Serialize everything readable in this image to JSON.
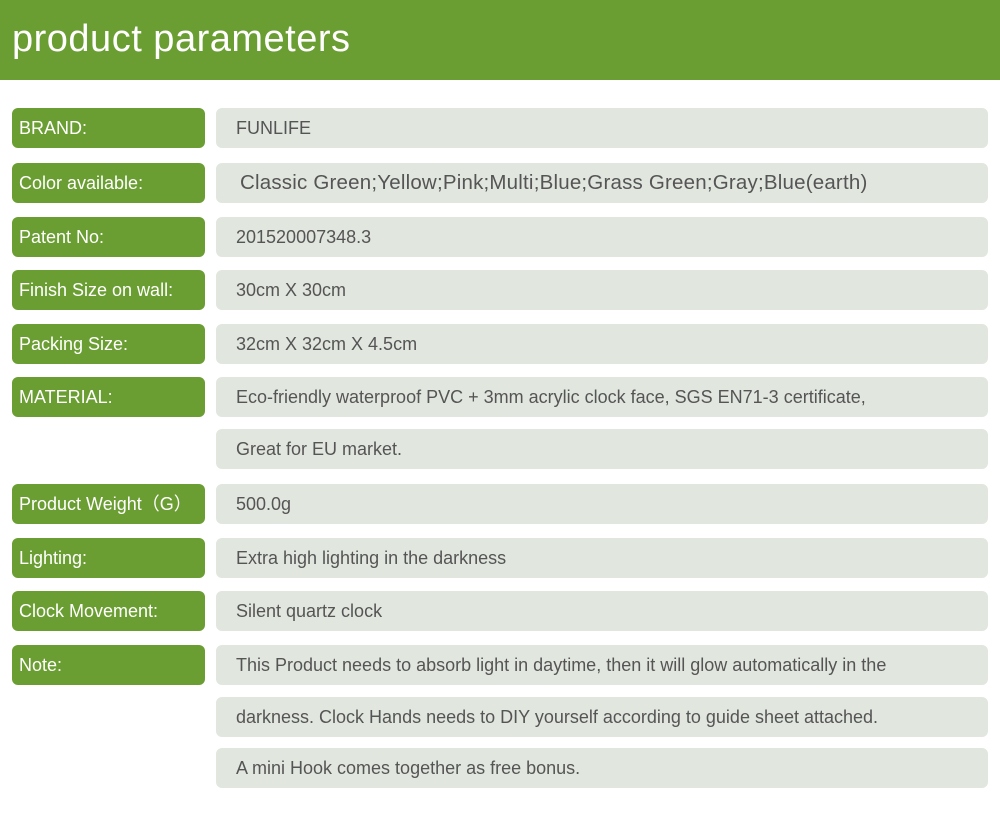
{
  "header": {
    "title": "product  parameters"
  },
  "rows": {
    "brand": {
      "label": "BRAND:",
      "value": "FUNLIFE"
    },
    "color": {
      "label": "Color available:",
      "value": "Classic Green;Yellow;Pink;Multi;Blue;Grass Green;Gray;Blue(earth)"
    },
    "patent": {
      "label": "Patent No:",
      "value": "201520007348.3"
    },
    "finish_size": {
      "label": "Finish Size on wall:",
      "value": "30cm X 30cm"
    },
    "packing_size": {
      "label": "Packing Size:",
      "value": "32cm X 32cm X 4.5cm"
    },
    "material": {
      "label": "MATERIAL:",
      "lines": [
        "Eco-friendly waterproof PVC + 3mm acrylic clock face,  SGS EN71-3 certificate,",
        "Great for EU market."
      ]
    },
    "weight": {
      "label": "Product Weight（G）",
      "value": "500.0g"
    },
    "lighting": {
      "label": "Lighting:",
      "value": "Extra high lighting in the darkness"
    },
    "movement": {
      "label": "Clock Movement:",
      "value": "Silent quartz clock"
    },
    "note": {
      "label": "Note:",
      "lines": [
        "This Product needs to absorb light in daytime, then it will glow automatically in the",
        "darkness.  Clock Hands needs to DIY yourself according to guide sheet attached.",
        "A mini Hook comes together as free bonus."
      ]
    }
  },
  "colors": {
    "accent_green": "#6b9e32",
    "value_bg": "#e1e6df",
    "value_text": "#555555"
  }
}
